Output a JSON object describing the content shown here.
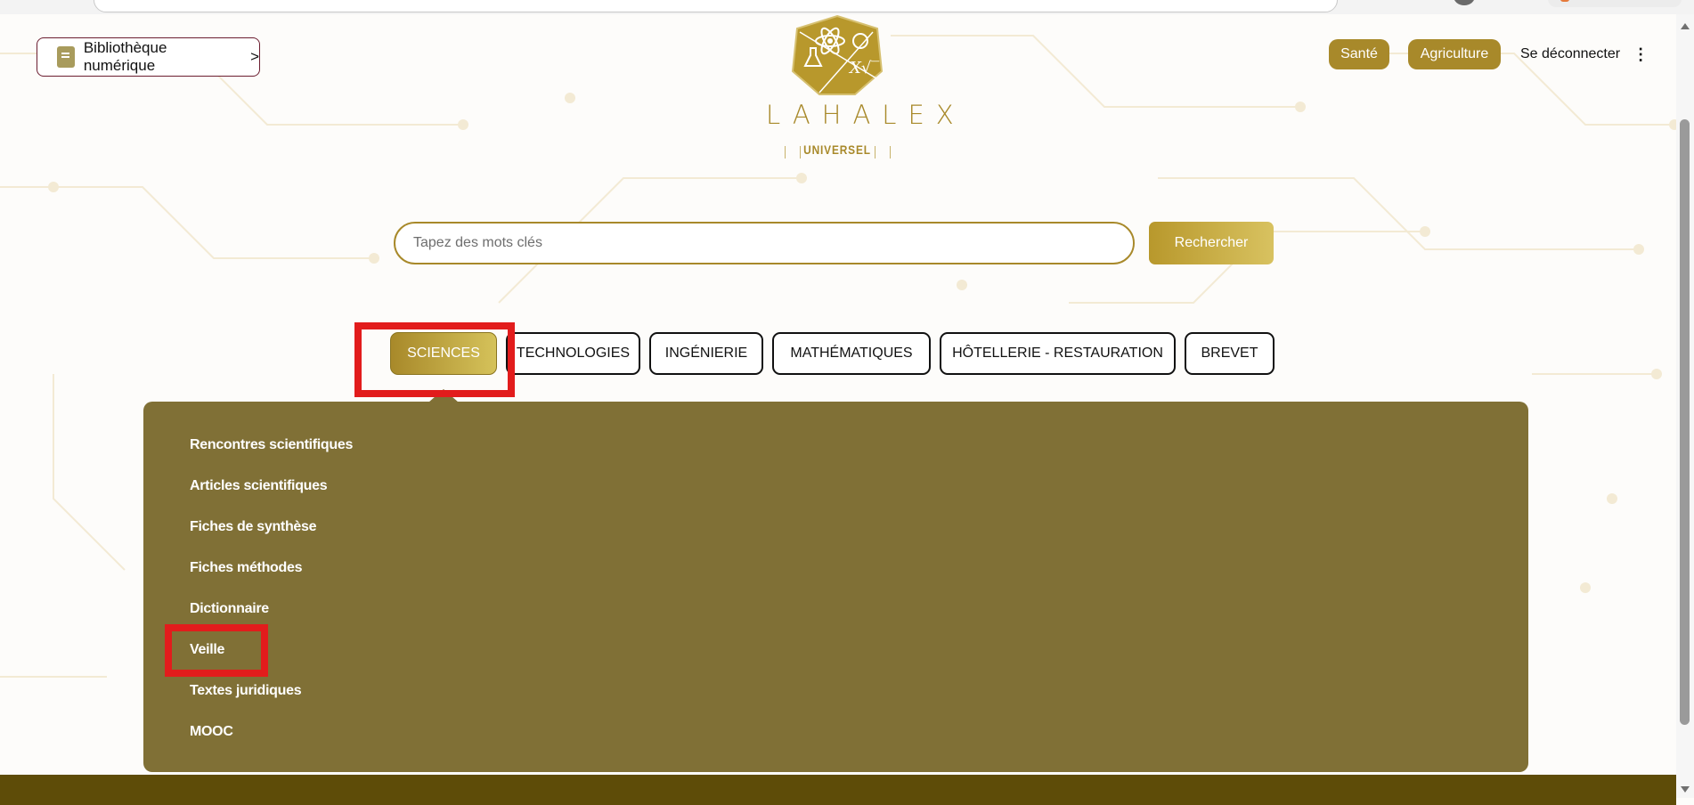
{
  "header": {
    "library_button_label": "Bibliothèque numérique",
    "library_button_chevron": ">",
    "logo": {
      "wordmark": "LAHALEX",
      "subtitle": "UNIVERSEL"
    },
    "nav": {
      "sante_label": "Santé",
      "agriculture_label": "Agriculture",
      "logout_label": "Se déconnecter",
      "more_icon": "⋮"
    }
  },
  "search": {
    "placeholder": "Tapez des mots clés",
    "value": "",
    "button_label": "Rechercher"
  },
  "categories": {
    "active": "SCIENCES",
    "tabs": [
      {
        "label": "SCIENCES"
      },
      {
        "label": "TECHNOLOGIES"
      },
      {
        "label": "INGÉNIERIE"
      },
      {
        "label": "MATHÉMATIQUES"
      },
      {
        "label": "HÔTELLERIE - RESTAURATION"
      },
      {
        "label": "BREVET"
      }
    ]
  },
  "dropdown": {
    "items": [
      {
        "label": "Rencontres scientifiques"
      },
      {
        "label": "Articles scientifiques"
      },
      {
        "label": "Fiches de synthèse"
      },
      {
        "label": "Fiches méthodes"
      },
      {
        "label": "Dictionnaire"
      },
      {
        "label": "Veille"
      },
      {
        "label": "Textes juridiques"
      },
      {
        "label": "MOOC"
      }
    ]
  },
  "colors": {
    "gold": "#a8892a",
    "panel": "#807036",
    "highlight": "#e21c1c",
    "footer": "#5e4c08"
  },
  "icons": {
    "library": "book-icon",
    "more": "kebab-menu-icon",
    "logo": "science-hexagon-logo"
  }
}
